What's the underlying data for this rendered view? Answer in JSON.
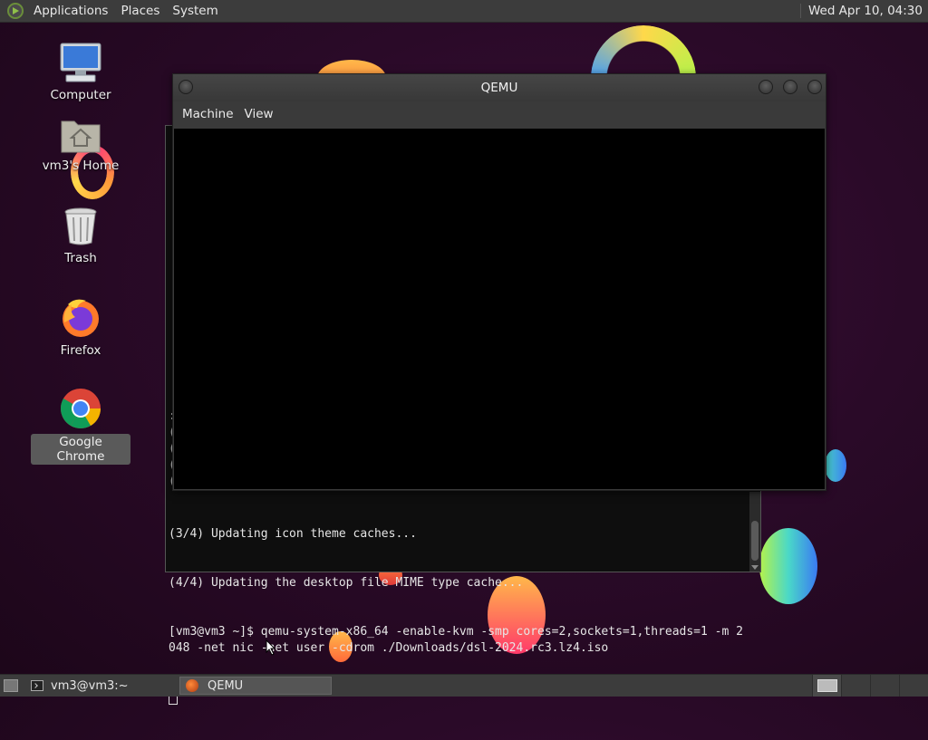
{
  "top_panel": {
    "menus": [
      "Applications",
      "Places",
      "System"
    ],
    "clock": "Wed Apr 10, 04:30"
  },
  "desktop": {
    "icons": [
      {
        "label": "Computer",
        "icon": "computer-icon"
      },
      {
        "label": "vm3's Home",
        "icon": "home-folder-icon"
      },
      {
        "label": "Trash",
        "icon": "trash-icon"
      },
      {
        "label": "Firefox",
        "icon": "firefox-icon"
      },
      {
        "label": "Google Chrome",
        "icon": "chrome-icon",
        "selected": true
      }
    ]
  },
  "terminal": {
    "side_glyphs": ":\n(\n(\n(\n(",
    "lines": [
      "(3/4) Updating icon theme caches...",
      "(4/4) Updating the desktop file MIME type cache...",
      "[vm3@vm3 ~]$ qemu-system-x86_64 -enable-kvm -smp cores=2,sockets=1,threads=1 -m 2048 -net nic -net user -cdrom ./Downloads/dsl-2024.rc3.lz4.iso"
    ]
  },
  "qemu_window": {
    "title": "QEMU",
    "menus": [
      "Machine",
      "View"
    ]
  },
  "bottom_panel": {
    "tasks": [
      {
        "label": "vm3@vm3:~",
        "icon": "terminal-icon",
        "active": false
      },
      {
        "label": "QEMU",
        "icon": "qemu-icon",
        "active": true
      }
    ]
  },
  "colors": {
    "panel": "#3c3c3c",
    "wallpaper": "#2a0a28",
    "terminal_bg": "#0e0e0e",
    "qemu_screen": "#000000"
  }
}
